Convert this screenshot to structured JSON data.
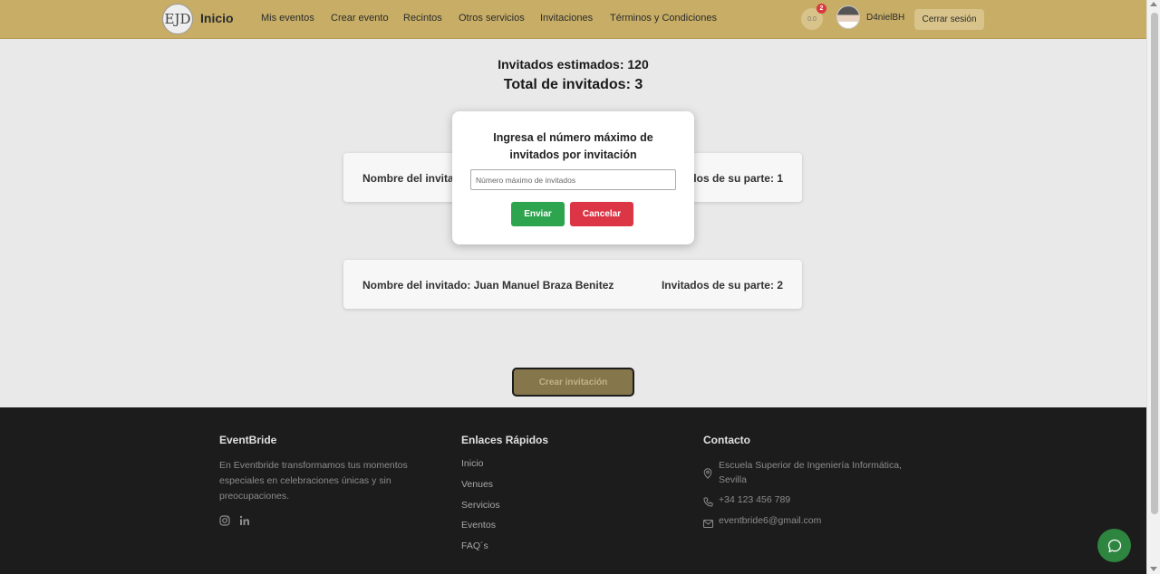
{
  "navbar": {
    "logo_text": "EJD",
    "brand": "Inicio",
    "links": [
      "Mis eventos",
      "Crear evento",
      "Recintos",
      "Otros servicios",
      "Invitaciones",
      "Términos y Condiciones"
    ],
    "notification_count": "2",
    "bell_placeholder": "0.0",
    "username": "D4nielBH",
    "logout_label": "Cerrar sesión"
  },
  "main": {
    "estimated_guests": "Invitados estimados: 120",
    "total_guests": "Total de invitados: 3",
    "cards": [
      {
        "name": "Nombre del invitado: ",
        "guests": "Invitados de su parte: 1"
      },
      {
        "name": "Nombre del invitado: Juan Manuel Braza Benitez",
        "guests": "Invitados de su parte: 2"
      }
    ],
    "create_button": "Crear invitación"
  },
  "modal": {
    "title": "Ingresa el número máximo de invitados por invitación",
    "input_placeholder": "Número máximo de invitados",
    "input_value": "",
    "send_label": "Enviar",
    "cancel_label": "Cancelar"
  },
  "footer": {
    "about_title": "EventBride",
    "about_text": "En Eventbride transformamos tus momentos especiales en celebraciones únicas y sin preocupaciones.",
    "links_title": "Enlaces Rápidos",
    "links": [
      "Inicio",
      "Venues",
      "Servicios",
      "Eventos",
      "FAQ´s"
    ],
    "contact_title": "Contacto",
    "address": "Escuela Superior de Ingeniería Informática, Sevilla",
    "phone": "+34 123 456 789",
    "email": "eventbride6@gmail.com"
  },
  "colors": {
    "navbar": "#c7ad66",
    "footer": "#1c1c1c",
    "send": "#2ea44f",
    "cancel": "#dc3545",
    "chat": "#2e8540"
  }
}
